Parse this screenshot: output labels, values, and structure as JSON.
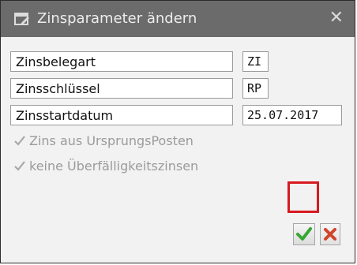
{
  "window": {
    "title": "Zinsparameter ändern"
  },
  "fields": [
    {
      "label": "Zinsbelegart",
      "value": "ZI"
    },
    {
      "label": "Zinsschlüssel",
      "value": "RP"
    },
    {
      "label": "Zinsstartdatum",
      "value": "25.07.2017"
    }
  ],
  "checkboxes": [
    {
      "label": "Zins aus UrsprungsPosten",
      "checked": true,
      "enabled": false
    },
    {
      "label": "keine Überfälligkeitszinsen",
      "checked": true,
      "enabled": false
    }
  ],
  "colors": {
    "highlight": "#d71920",
    "confirm": "#3aa635",
    "cancel": "#d0452b"
  }
}
